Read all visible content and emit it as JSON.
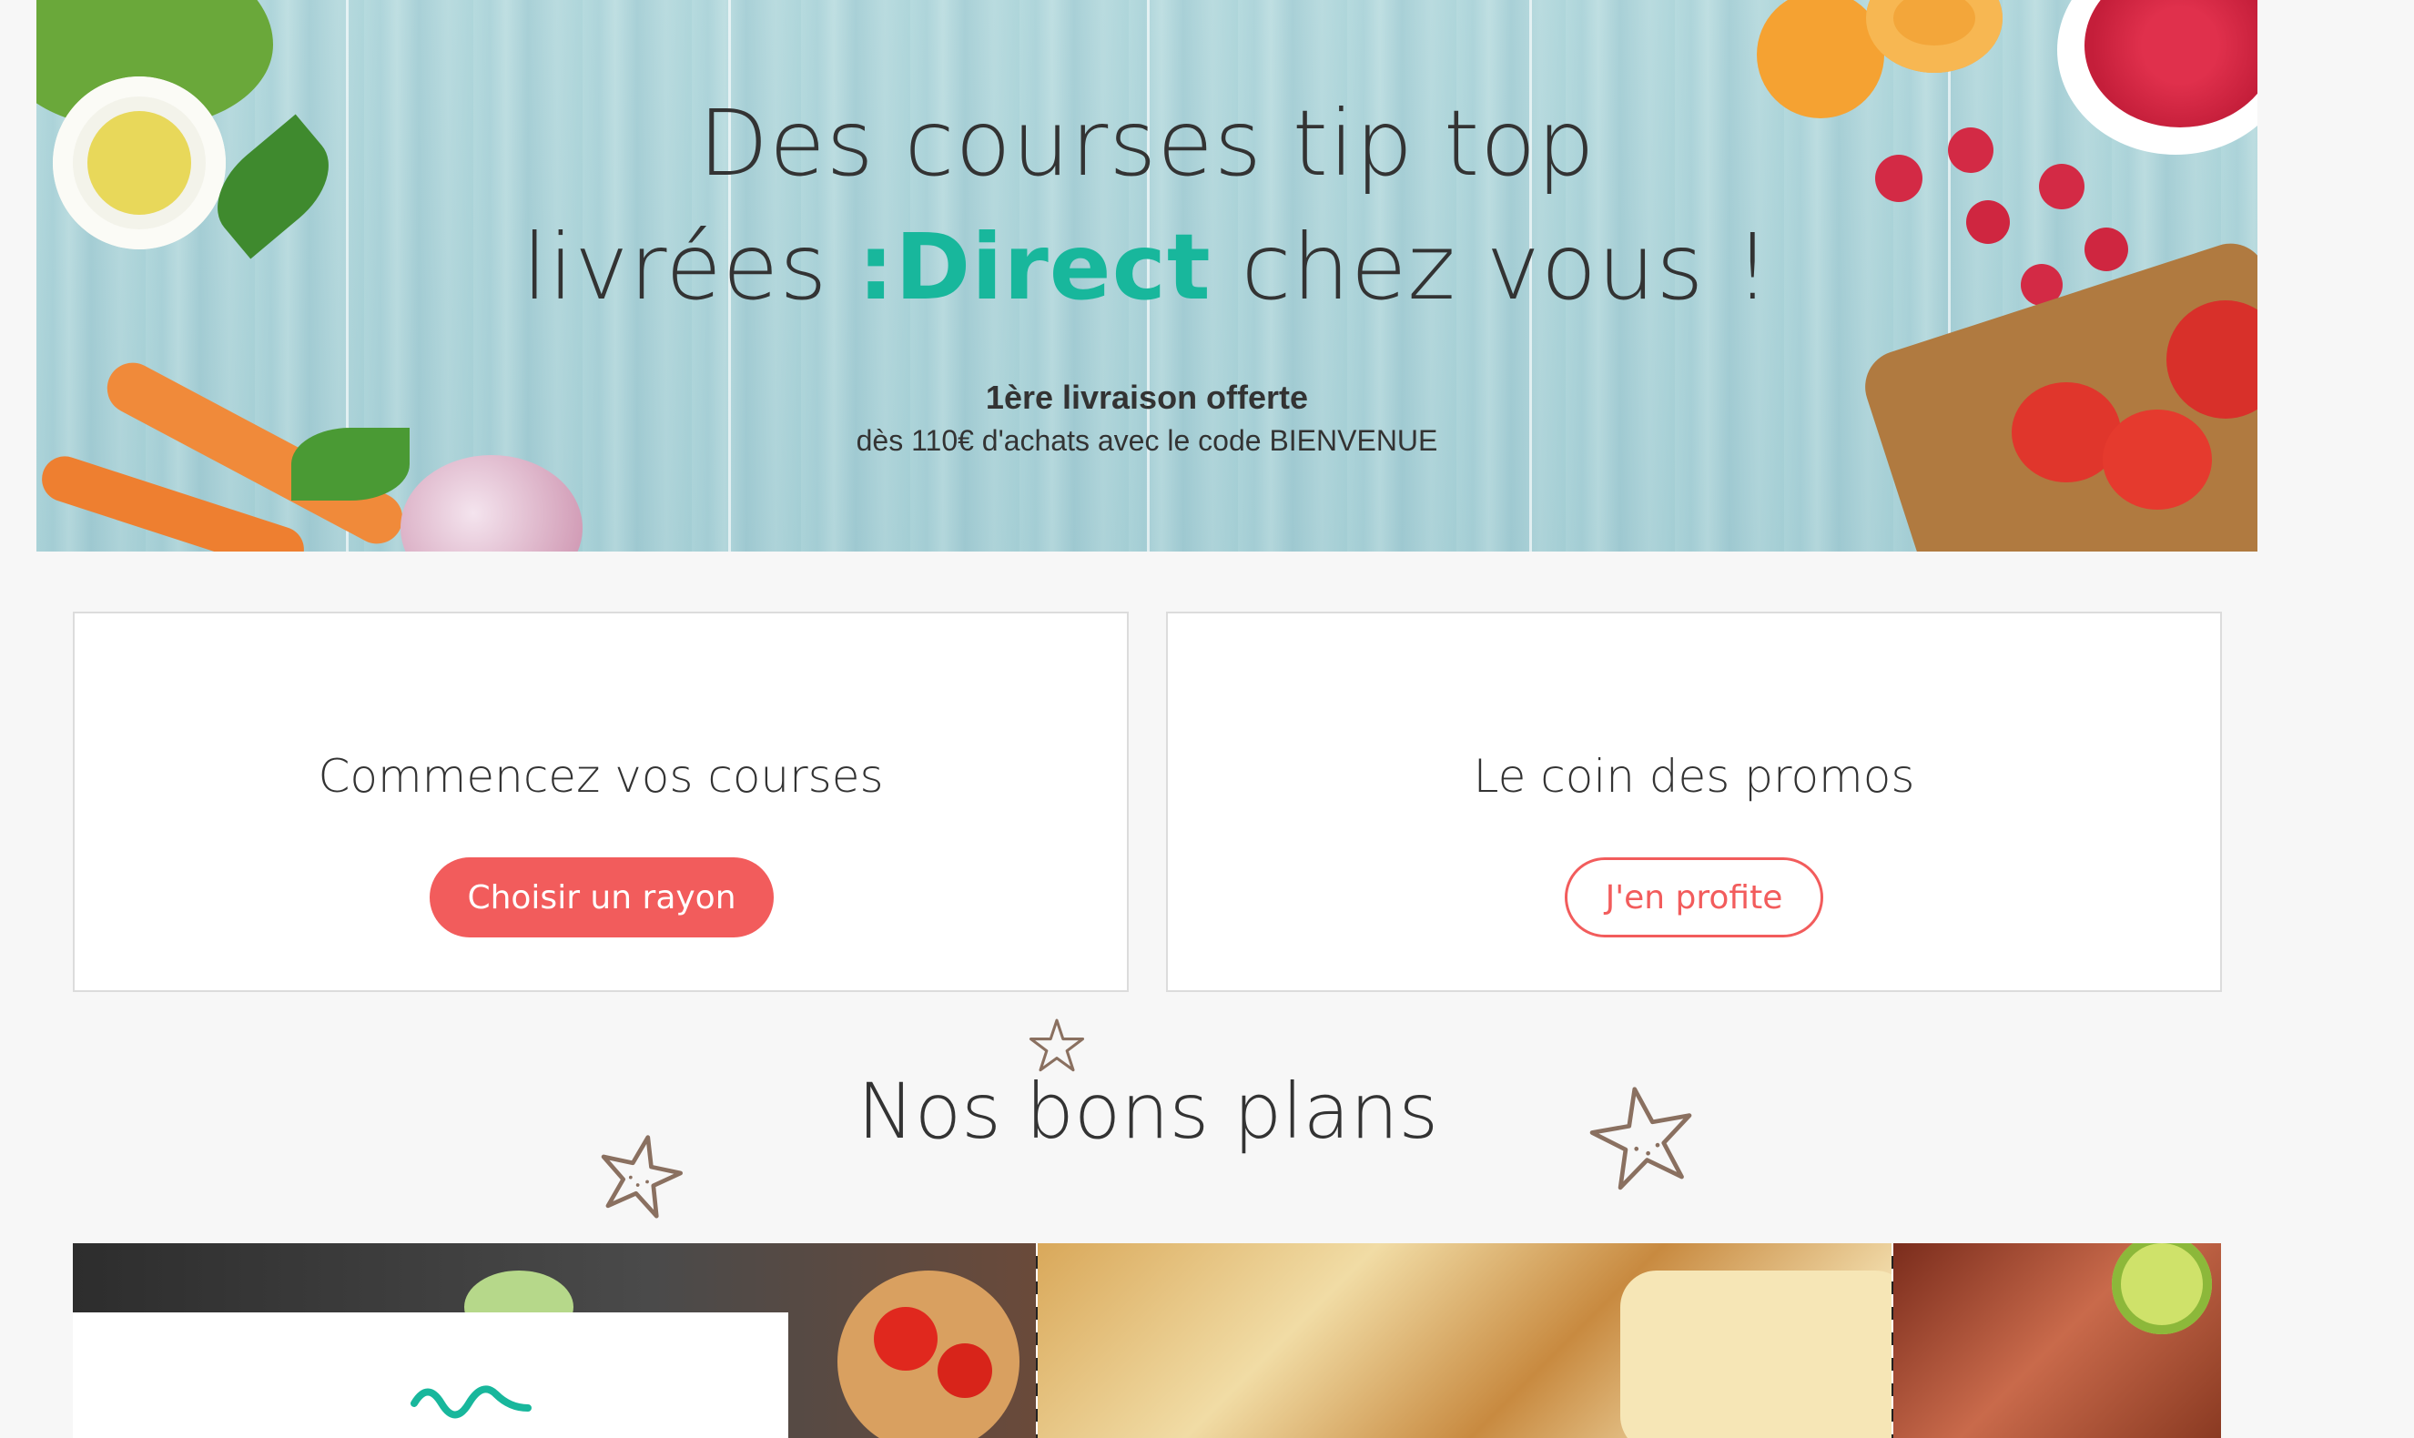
{
  "hero": {
    "title_line1": "Des courses tip top",
    "title_line2_pre": "livrées ",
    "title_brand": ":Direct",
    "title_line2_post": " chez vous !",
    "offer_title": "1ère livraison offerte",
    "offer_detail": "dès 110€ d'achats avec le code BIENVENUE"
  },
  "cards": {
    "shop": {
      "title": "Commencez vos courses",
      "button": "Choisir un rayon"
    },
    "promos": {
      "title": "Le coin des promos",
      "button": "J'en profite"
    }
  },
  "deals": {
    "title": "Nos bons plans"
  },
  "colors": {
    "brand": "#18b79c",
    "accent": "#f25c5c",
    "text": "#333333",
    "background": "#f7f7f7"
  },
  "icons": [
    "star-icon"
  ]
}
